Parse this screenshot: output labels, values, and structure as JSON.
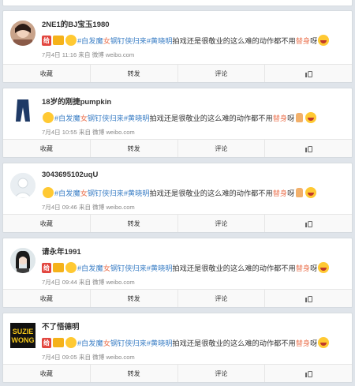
{
  "posts": [
    {
      "username": "2NE1的BJ宝玉1980",
      "badge": "给",
      "content": {
        "pre": "#白发魔",
        "girl": "女",
        "link": "钢钉侠归来",
        "tag2": "#黄晓明",
        "tail": "拍戏还是很敬业的这么难的动作都不用",
        "stunt": "替身",
        "end": "呀"
      },
      "meta": "7月4日 11:16 来自 微博 weibo.com"
    },
    {
      "username": "18岁的刚捷pumpkin",
      "content": {
        "pre": "#白发魔",
        "girl": "女",
        "link": "钢钉侠归来",
        "tag2": "#黄晓明",
        "tail": "拍戏还是很敬业的这么难的动作都不用",
        "stunt": "替身",
        "end": "呀"
      },
      "meta": "7月4日 10:55 来自 微博 weibo.com"
    },
    {
      "username": "3043695102uqU",
      "content": {
        "pre": "#白发魔",
        "girl": "女",
        "link": "钢钉侠归来",
        "tag2": "#黄晓明",
        "tail": "拍戏还是很敬业的这么难的动作都不用",
        "stunt": "替身",
        "end": "呀"
      },
      "meta": "7月4日 09:46 来自 微博 weibo.com"
    },
    {
      "username": "请永年1991",
      "badge": "给",
      "content": {
        "pre": "#白发魔",
        "girl": "女",
        "link": "钢钉侠归来",
        "tag2": "#黄晓明",
        "tail": "拍戏还是很敬业的这么难的动作都不用",
        "stunt": "替身",
        "end": "呀"
      },
      "meta": "7月4日 09:44 来自 微博 weibo.com"
    },
    {
      "username": "不了悟德明",
      "badge": "给",
      "avatar_text": "SUZIE WONG",
      "content": {
        "pre": "#白发魔",
        "girl": "女",
        "link": "钢钉侠归来",
        "tag2": "#黄晓明",
        "tail": "拍戏还是很敬业的这么难的动作都不用",
        "stunt": "替身",
        "end": "呀"
      },
      "meta": "7月4日 09:05 来自 微博 weibo.com"
    }
  ],
  "actions": {
    "collect": "收藏",
    "repost": "转发",
    "comment": "评论"
  },
  "icons": {
    "like": "thumbs-up-icon",
    "emoji": "smiley-icon",
    "thumb_emoji": "thumbs-up-emoji-icon"
  },
  "colors": {
    "highlight": "#eb7350",
    "link": "#3a7ec5",
    "background": "#dfe4ea"
  }
}
